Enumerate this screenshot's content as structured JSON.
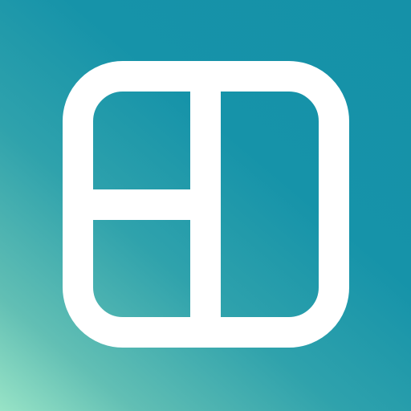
{
  "app_icon": {
    "name": "collage-layout-icon",
    "colors": {
      "gradient_top_right": "#1591a8",
      "gradient_mid": "#2fa2ac",
      "gradient_bottom_left": "#98e3c6",
      "glyph": "#ffffff"
    }
  }
}
